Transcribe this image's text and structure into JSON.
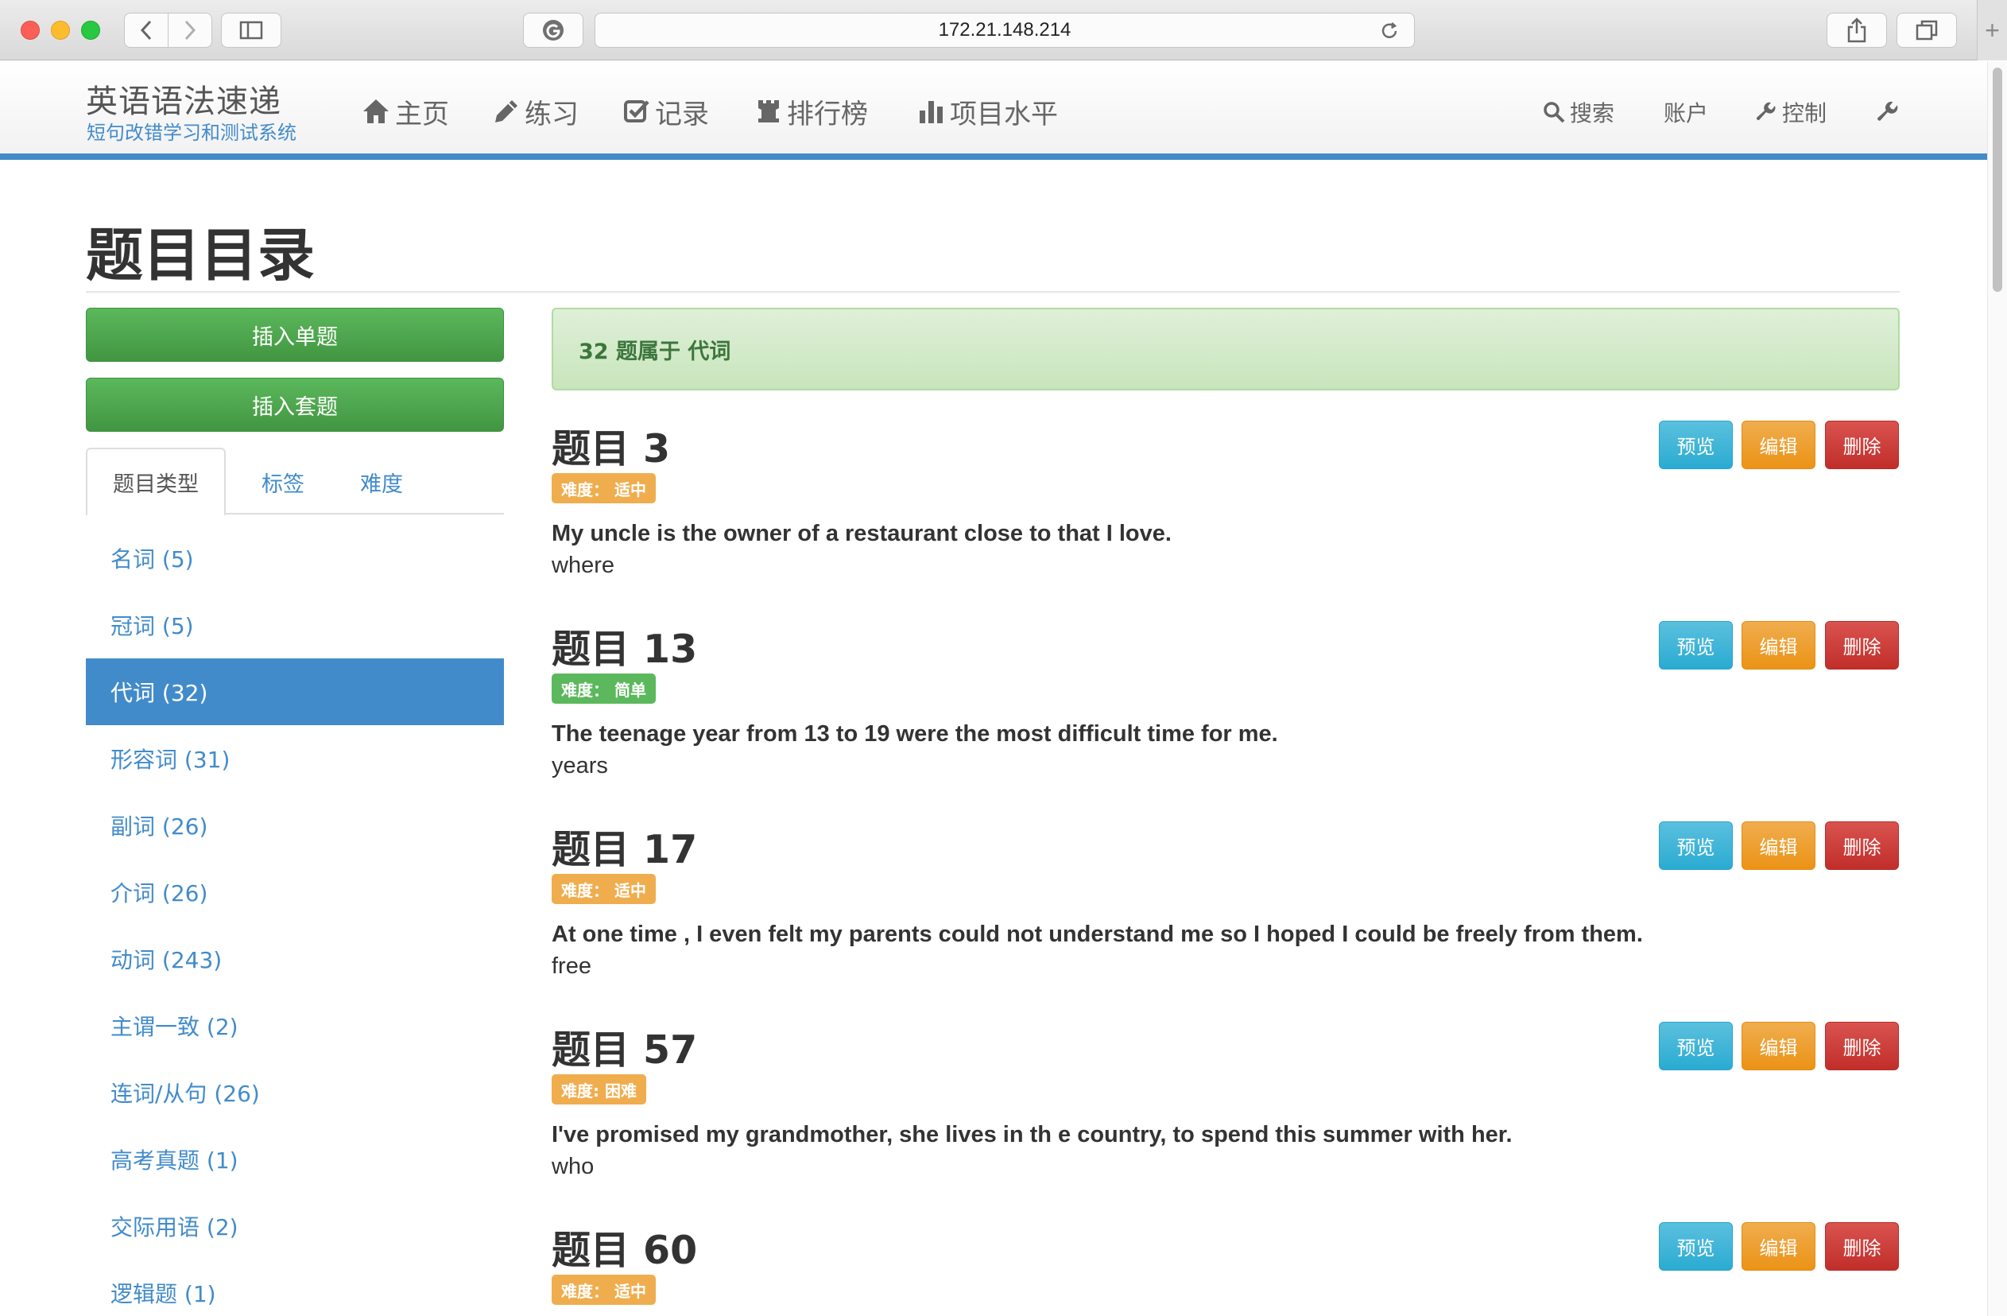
{
  "browser": {
    "url": "172.21.148.214"
  },
  "site": {
    "brand_title": "英语语法速递",
    "brand_subtitle": "短句改错学习和测试系统",
    "nav": [
      {
        "label": "主页",
        "icon": "home-icon"
      },
      {
        "label": "练习",
        "icon": "pencil-icon"
      },
      {
        "label": "记录",
        "icon": "check-square-icon"
      },
      {
        "label": "排行榜",
        "icon": "tower-icon"
      },
      {
        "label": "项目水平",
        "icon": "bar-chart-icon"
      }
    ],
    "nav_right": {
      "search": "搜索",
      "account": "账户",
      "control": "控制"
    },
    "accent_color": "#428bca"
  },
  "page": {
    "title": "题目目录",
    "insert_single": "插入单题",
    "insert_set": "插入套题",
    "tabs": [
      "题目类型",
      "标签",
      "难度"
    ],
    "categories": [
      "名词 (5)",
      "冠词 (5)",
      "代词 (32)",
      "形容词 (31)",
      "副词 (26)",
      "介词 (26)",
      "动词 (243)",
      "主谓一致 (2)",
      "连词/从句 (26)",
      "高考真题 (1)",
      "交际用语 (2)",
      "逻辑题 (1)"
    ],
    "active_category": "代词 (32)",
    "alert": "32 题属于 代词",
    "button_labels": {
      "preview": "预览",
      "edit": "编辑",
      "delete": "删除"
    },
    "questions": [
      {
        "title": "题目 3",
        "difficulty": "难度： 适中",
        "difficulty_color": "#f0ad4e",
        "text": "My uncle is the owner of a restaurant close to that I love.",
        "answer": "where"
      },
      {
        "title": "题目 13",
        "difficulty": "难度： 简单",
        "difficulty_color": "#5cb85c",
        "text": "The teenage year from 13 to 19 were the most difficult time for me.",
        "answer": "years"
      },
      {
        "title": "题目 17",
        "difficulty": "难度： 适中",
        "difficulty_color": "#f0ad4e",
        "text": "At one time , I even felt my parents could not understand me so I hoped I could be freely from them.",
        "answer": "free"
      },
      {
        "title": "题目 57",
        "difficulty": "难度: 困难",
        "difficulty_color": "#f0ad4e",
        "text": "I've promised my grandmother, she lives in th e country, to spend this summer with her.",
        "answer": "who"
      },
      {
        "title": "题目 60",
        "difficulty": "难度： 适中",
        "difficulty_color": "#f0ad4e",
        "text": "",
        "answer": ""
      }
    ]
  }
}
